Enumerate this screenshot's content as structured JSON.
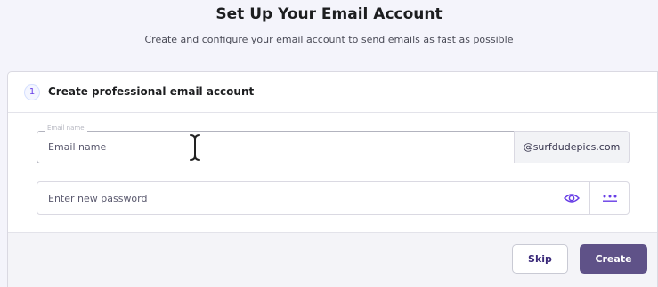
{
  "header": {
    "title": "Set Up Your Email Account",
    "subtitle": "Create and configure your email account to send emails as fast as possible"
  },
  "step": {
    "number": "1",
    "title": "Create professional email account"
  },
  "email_field": {
    "floating_label": "Email name",
    "placeholder": "Email name",
    "value": "",
    "domain": "@surfdudepics.com"
  },
  "password_field": {
    "placeholder": "Enter new password",
    "value": "",
    "toggle_icon": "eye-icon",
    "generate_icon": "password-dots-icon"
  },
  "actions": {
    "skip_label": "Skip",
    "create_label": "Create"
  },
  "colors": {
    "accent": "#673de6",
    "create_button": "#5f5288",
    "page_background": "#f4f4fb"
  }
}
